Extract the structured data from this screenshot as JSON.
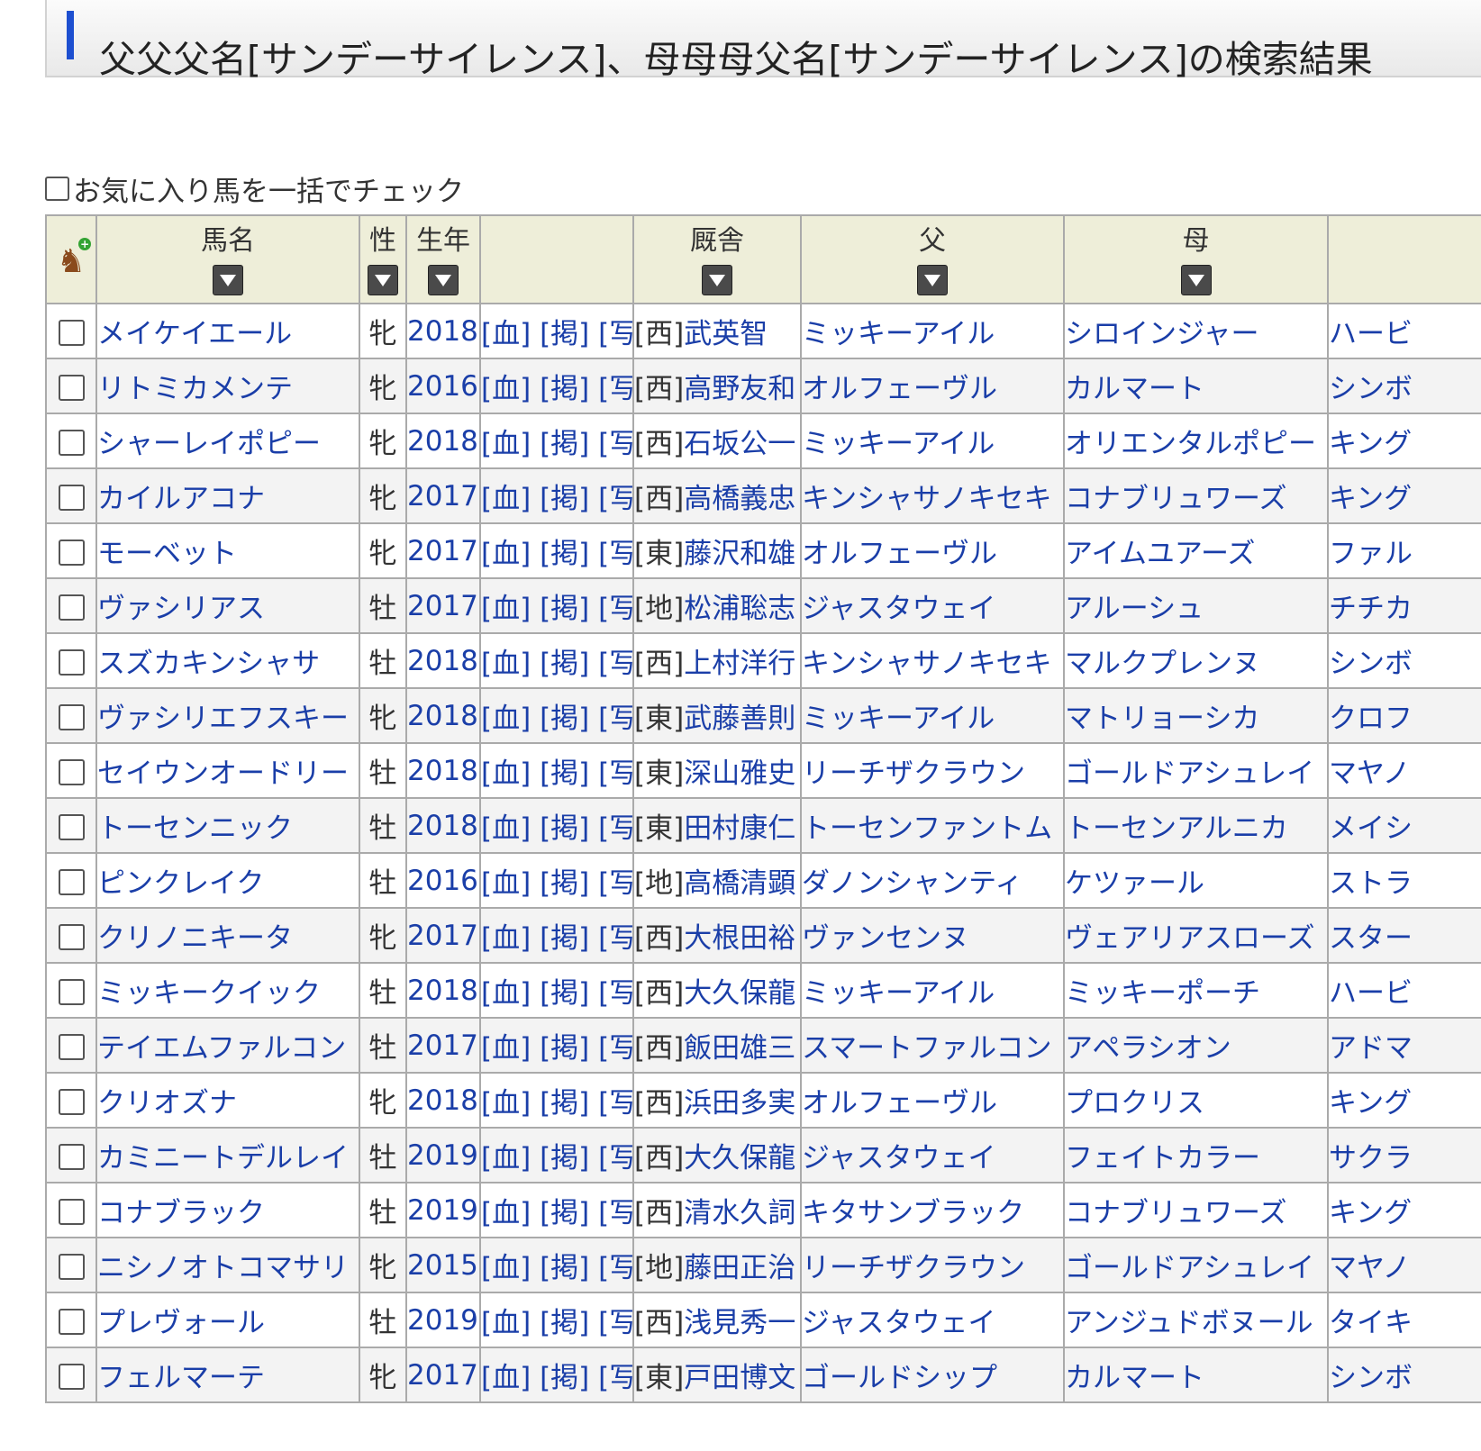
{
  "page_title": "父父父名[サンデーサイレンス]、母母母父名[サンデーサイレンス]の検索結果",
  "bulk_check_label": "お気に入り馬を一括でチェック",
  "columns": {
    "name": "馬名",
    "sex": "性",
    "year": "生年",
    "links": "",
    "trainer": "厩舎",
    "sire": "父",
    "dam": "母",
    "bms": ""
  },
  "link_labels": {
    "pedigree": "[血]",
    "board": "[掲]",
    "photo": "[写]"
  },
  "rows": [
    {
      "name": "メイケイエール",
      "sex": "牝",
      "year": "2018",
      "region": "[西]",
      "trainer": "武英智",
      "sire": "ミッキーアイル",
      "dam": "シロインジャー",
      "bms": "ハービ"
    },
    {
      "name": "リトミカメンテ",
      "sex": "牝",
      "year": "2016",
      "region": "[西]",
      "trainer": "高野友和",
      "sire": "オルフェーヴル",
      "dam": "カルマート",
      "bms": "シンボ"
    },
    {
      "name": "シャーレイポピー",
      "sex": "牝",
      "year": "2018",
      "region": "[西]",
      "trainer": "石坂公一",
      "sire": "ミッキーアイル",
      "dam": "オリエンタルポピー",
      "bms": "キング"
    },
    {
      "name": "カイルアコナ",
      "sex": "牝",
      "year": "2017",
      "region": "[西]",
      "trainer": "高橋義忠",
      "sire": "キンシャサノキセキ",
      "dam": "コナブリュワーズ",
      "bms": "キング"
    },
    {
      "name": "モーベット",
      "sex": "牝",
      "year": "2017",
      "region": "[東]",
      "trainer": "藤沢和雄",
      "sire": "オルフェーヴル",
      "dam": "アイムユアーズ",
      "bms": "ファル"
    },
    {
      "name": "ヴァシリアス",
      "sex": "牡",
      "year": "2017",
      "region": "[地]",
      "trainer": "松浦聡志",
      "sire": "ジャスタウェイ",
      "dam": "アルーシュ",
      "bms": "チチカ"
    },
    {
      "name": "スズカキンシャサ",
      "sex": "牡",
      "year": "2018",
      "region": "[西]",
      "trainer": "上村洋行",
      "sire": "キンシャサノキセキ",
      "dam": "マルクプレンヌ",
      "bms": "シンボ"
    },
    {
      "name": "ヴァシリエフスキー",
      "sex": "牝",
      "year": "2018",
      "region": "[東]",
      "trainer": "武藤善則",
      "sire": "ミッキーアイル",
      "dam": "マトリョーシカ",
      "bms": "クロフ"
    },
    {
      "name": "セイウンオードリー",
      "sex": "牡",
      "year": "2018",
      "region": "[東]",
      "trainer": "深山雅史",
      "sire": "リーチザクラウン",
      "dam": "ゴールドアシュレイ",
      "bms": "マヤノ"
    },
    {
      "name": "トーセンニック",
      "sex": "牡",
      "year": "2018",
      "region": "[東]",
      "trainer": "田村康仁",
      "sire": "トーセンファントム",
      "dam": "トーセンアルニカ",
      "bms": "メイシ"
    },
    {
      "name": "ピンクレイク",
      "sex": "牡",
      "year": "2016",
      "region": "[地]",
      "trainer": "高橋清顕",
      "sire": "ダノンシャンティ",
      "dam": "ケツァール",
      "bms": "ストラ"
    },
    {
      "name": "クリノニキータ",
      "sex": "牝",
      "year": "2017",
      "region": "[西]",
      "trainer": "大根田裕",
      "sire": "ヴァンセンヌ",
      "dam": "ヴェアリアスローズ",
      "bms": "スター"
    },
    {
      "name": "ミッキークイック",
      "sex": "牡",
      "year": "2018",
      "region": "[西]",
      "trainer": "大久保龍",
      "sire": "ミッキーアイル",
      "dam": "ミッキーポーチ",
      "bms": "ハービ"
    },
    {
      "name": "テイエムファルコン",
      "sex": "牡",
      "year": "2017",
      "region": "[西]",
      "trainer": "飯田雄三",
      "sire": "スマートファルコン",
      "dam": "アペラシオン",
      "bms": "アドマ"
    },
    {
      "name": "クリオズナ",
      "sex": "牝",
      "year": "2018",
      "region": "[西]",
      "trainer": "浜田多実",
      "sire": "オルフェーヴル",
      "dam": "プロクリス",
      "bms": "キング"
    },
    {
      "name": "カミニートデルレイ",
      "sex": "牡",
      "year": "2019",
      "region": "[西]",
      "trainer": "大久保龍",
      "sire": "ジャスタウェイ",
      "dam": "フェイトカラー",
      "bms": "サクラ"
    },
    {
      "name": "コナブラック",
      "sex": "牡",
      "year": "2019",
      "region": "[西]",
      "trainer": "清水久詞",
      "sire": "キタサンブラック",
      "dam": "コナブリュワーズ",
      "bms": "キング"
    },
    {
      "name": "ニシノオトコマサリ",
      "sex": "牝",
      "year": "2015",
      "region": "[地]",
      "trainer": "藤田正治",
      "sire": "リーチザクラウン",
      "dam": "ゴールドアシュレイ",
      "bms": "マヤノ"
    },
    {
      "name": "プレヴォール",
      "sex": "牡",
      "year": "2019",
      "region": "[西]",
      "trainer": "浅見秀一",
      "sire": "ジャスタウェイ",
      "dam": "アンジュドボヌール",
      "bms": "タイキ"
    },
    {
      "name": "フェルマーテ",
      "sex": "牝",
      "year": "2017",
      "region": "[東]",
      "trainer": "戸田博文",
      "sire": "ゴールドシップ",
      "dam": "カルマート",
      "bms": "シンボ"
    }
  ],
  "colors": {
    "accent": "#1d4fd0",
    "link": "#1a3ea8",
    "header_bg": "#eeeed9"
  }
}
